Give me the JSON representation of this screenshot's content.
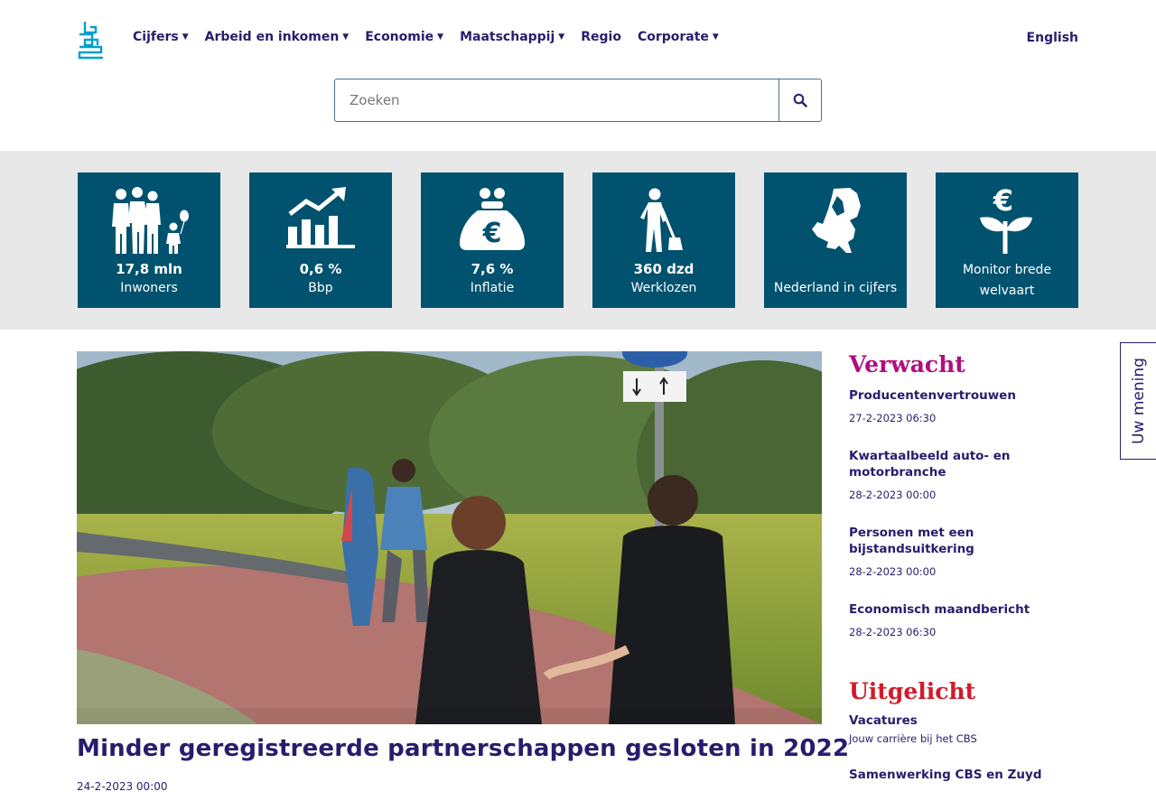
{
  "nav": {
    "items": [
      {
        "label": "Cijfers",
        "dropdown": true
      },
      {
        "label": "Arbeid en inkomen",
        "dropdown": true
      },
      {
        "label": "Economie",
        "dropdown": true
      },
      {
        "label": "Maatschappij",
        "dropdown": true
      },
      {
        "label": "Regio",
        "dropdown": false
      },
      {
        "label": "Corporate",
        "dropdown": true
      }
    ],
    "language": "English"
  },
  "search": {
    "placeholder": "Zoeken"
  },
  "tiles": [
    {
      "icon": "family-icon",
      "value": "17,8 mln",
      "label": "Inwoners"
    },
    {
      "icon": "growth-chart-icon",
      "value": "0,6 %",
      "label": "Bbp"
    },
    {
      "icon": "money-bag-euro-icon",
      "value": "7,6 %",
      "label": "Inflatie"
    },
    {
      "icon": "person-shovel-icon",
      "value": "360 dzd",
      "label": "Werklozen"
    },
    {
      "icon": "netherlands-map-icon",
      "label": "Nederland in cijfers"
    },
    {
      "icon": "plant-euro-icon",
      "label_line1": "Monitor brede",
      "label_line2": "welvaart"
    }
  ],
  "main": {
    "headline": "Minder geregistreerde partnerschappen gesloten in 2022",
    "date": "24-2-2023 00:00"
  },
  "verwacht": {
    "title": "Verwacht",
    "items": [
      {
        "title": "Producentenvertrouwen",
        "date": "27-2-2023 06:30"
      },
      {
        "title": "Kwartaalbeeld auto- en motorbranche",
        "date": "28-2-2023 00:00"
      },
      {
        "title": "Personen met een bijstandsuitkering",
        "date": "28-2-2023 00:00"
      },
      {
        "title": "Economisch maandbericht",
        "date": "28-2-2023 06:30"
      }
    ]
  },
  "uitgelicht": {
    "title": "Uitgelicht",
    "items": [
      {
        "title": "Vacatures",
        "subtitle": "Jouw carrière bij het CBS"
      },
      {
        "title": "Samenwerking CBS en Zuyd"
      }
    ]
  },
  "feedback": {
    "label": "Uw mening"
  },
  "colors": {
    "brand_dark": "#271d6c",
    "tile": "#00526e",
    "verwacht": "#af0e80",
    "uitgelicht": "#d01b2a",
    "band": "#e8e8e8"
  }
}
